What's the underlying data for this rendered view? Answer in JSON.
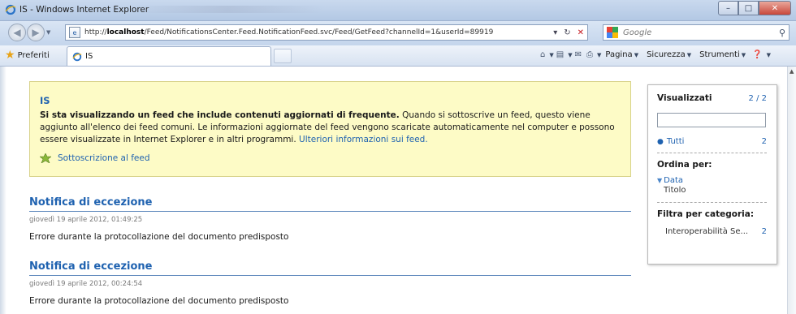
{
  "window": {
    "title": "IS - Windows Internet Explorer",
    "buttons": {
      "minimize": "–",
      "maximize": "□",
      "close": "✕"
    }
  },
  "address": {
    "url_prefix": "http://",
    "url_host": "localhost",
    "url_path": "/Feed/NotificationsCenter.Feed.NotificationFeed.svc/Feed/GetFeed?channelId=1&userId=89919",
    "search_placeholder": "Google"
  },
  "favorites": {
    "label": "Preferiti",
    "tab_label": "IS"
  },
  "commands": {
    "pagina": "Pagina",
    "sicurezza": "Sicurezza",
    "strumenti": "Strumenti"
  },
  "banner": {
    "title": "IS",
    "bold_text": "Si sta visualizzando un feed che include contenuti aggiornati di frequente.",
    "text": " Quando si sottoscrive un feed, questo viene aggiunto all'elenco dei feed comuni. Le informazioni aggiornate del feed vengono scaricate automaticamente nel computer e possono essere visualizzate in Internet Explorer e in altri programmi. ",
    "link": "Ulteriori informazioni sui feed.",
    "subscribe": "Sottoscrizione al feed"
  },
  "items": [
    {
      "title": "Notifica di eccezione",
      "date": "giovedì 19 aprile 2012, 01:49:25",
      "body": "Errore durante la protocollazione del documento predisposto"
    },
    {
      "title": "Notifica di eccezione",
      "date": "giovedì 19 aprile 2012, 00:24:54",
      "body": "Errore durante la protocollazione del documento predisposto"
    }
  ],
  "panel": {
    "viewed_label": "Visualizzati",
    "viewed_count": "2 / 2",
    "all_label": "Tutti",
    "all_count": "2",
    "sort_label": "Ordina per:",
    "sort_date": "Data",
    "sort_title": "Titolo",
    "filter_label": "Filtra per categoria:",
    "category_label": "Interoperabilità Se...",
    "category_count": "2"
  },
  "colors": {
    "accent": "#1f62b0",
    "banner_bg": "#fdfbc6"
  }
}
